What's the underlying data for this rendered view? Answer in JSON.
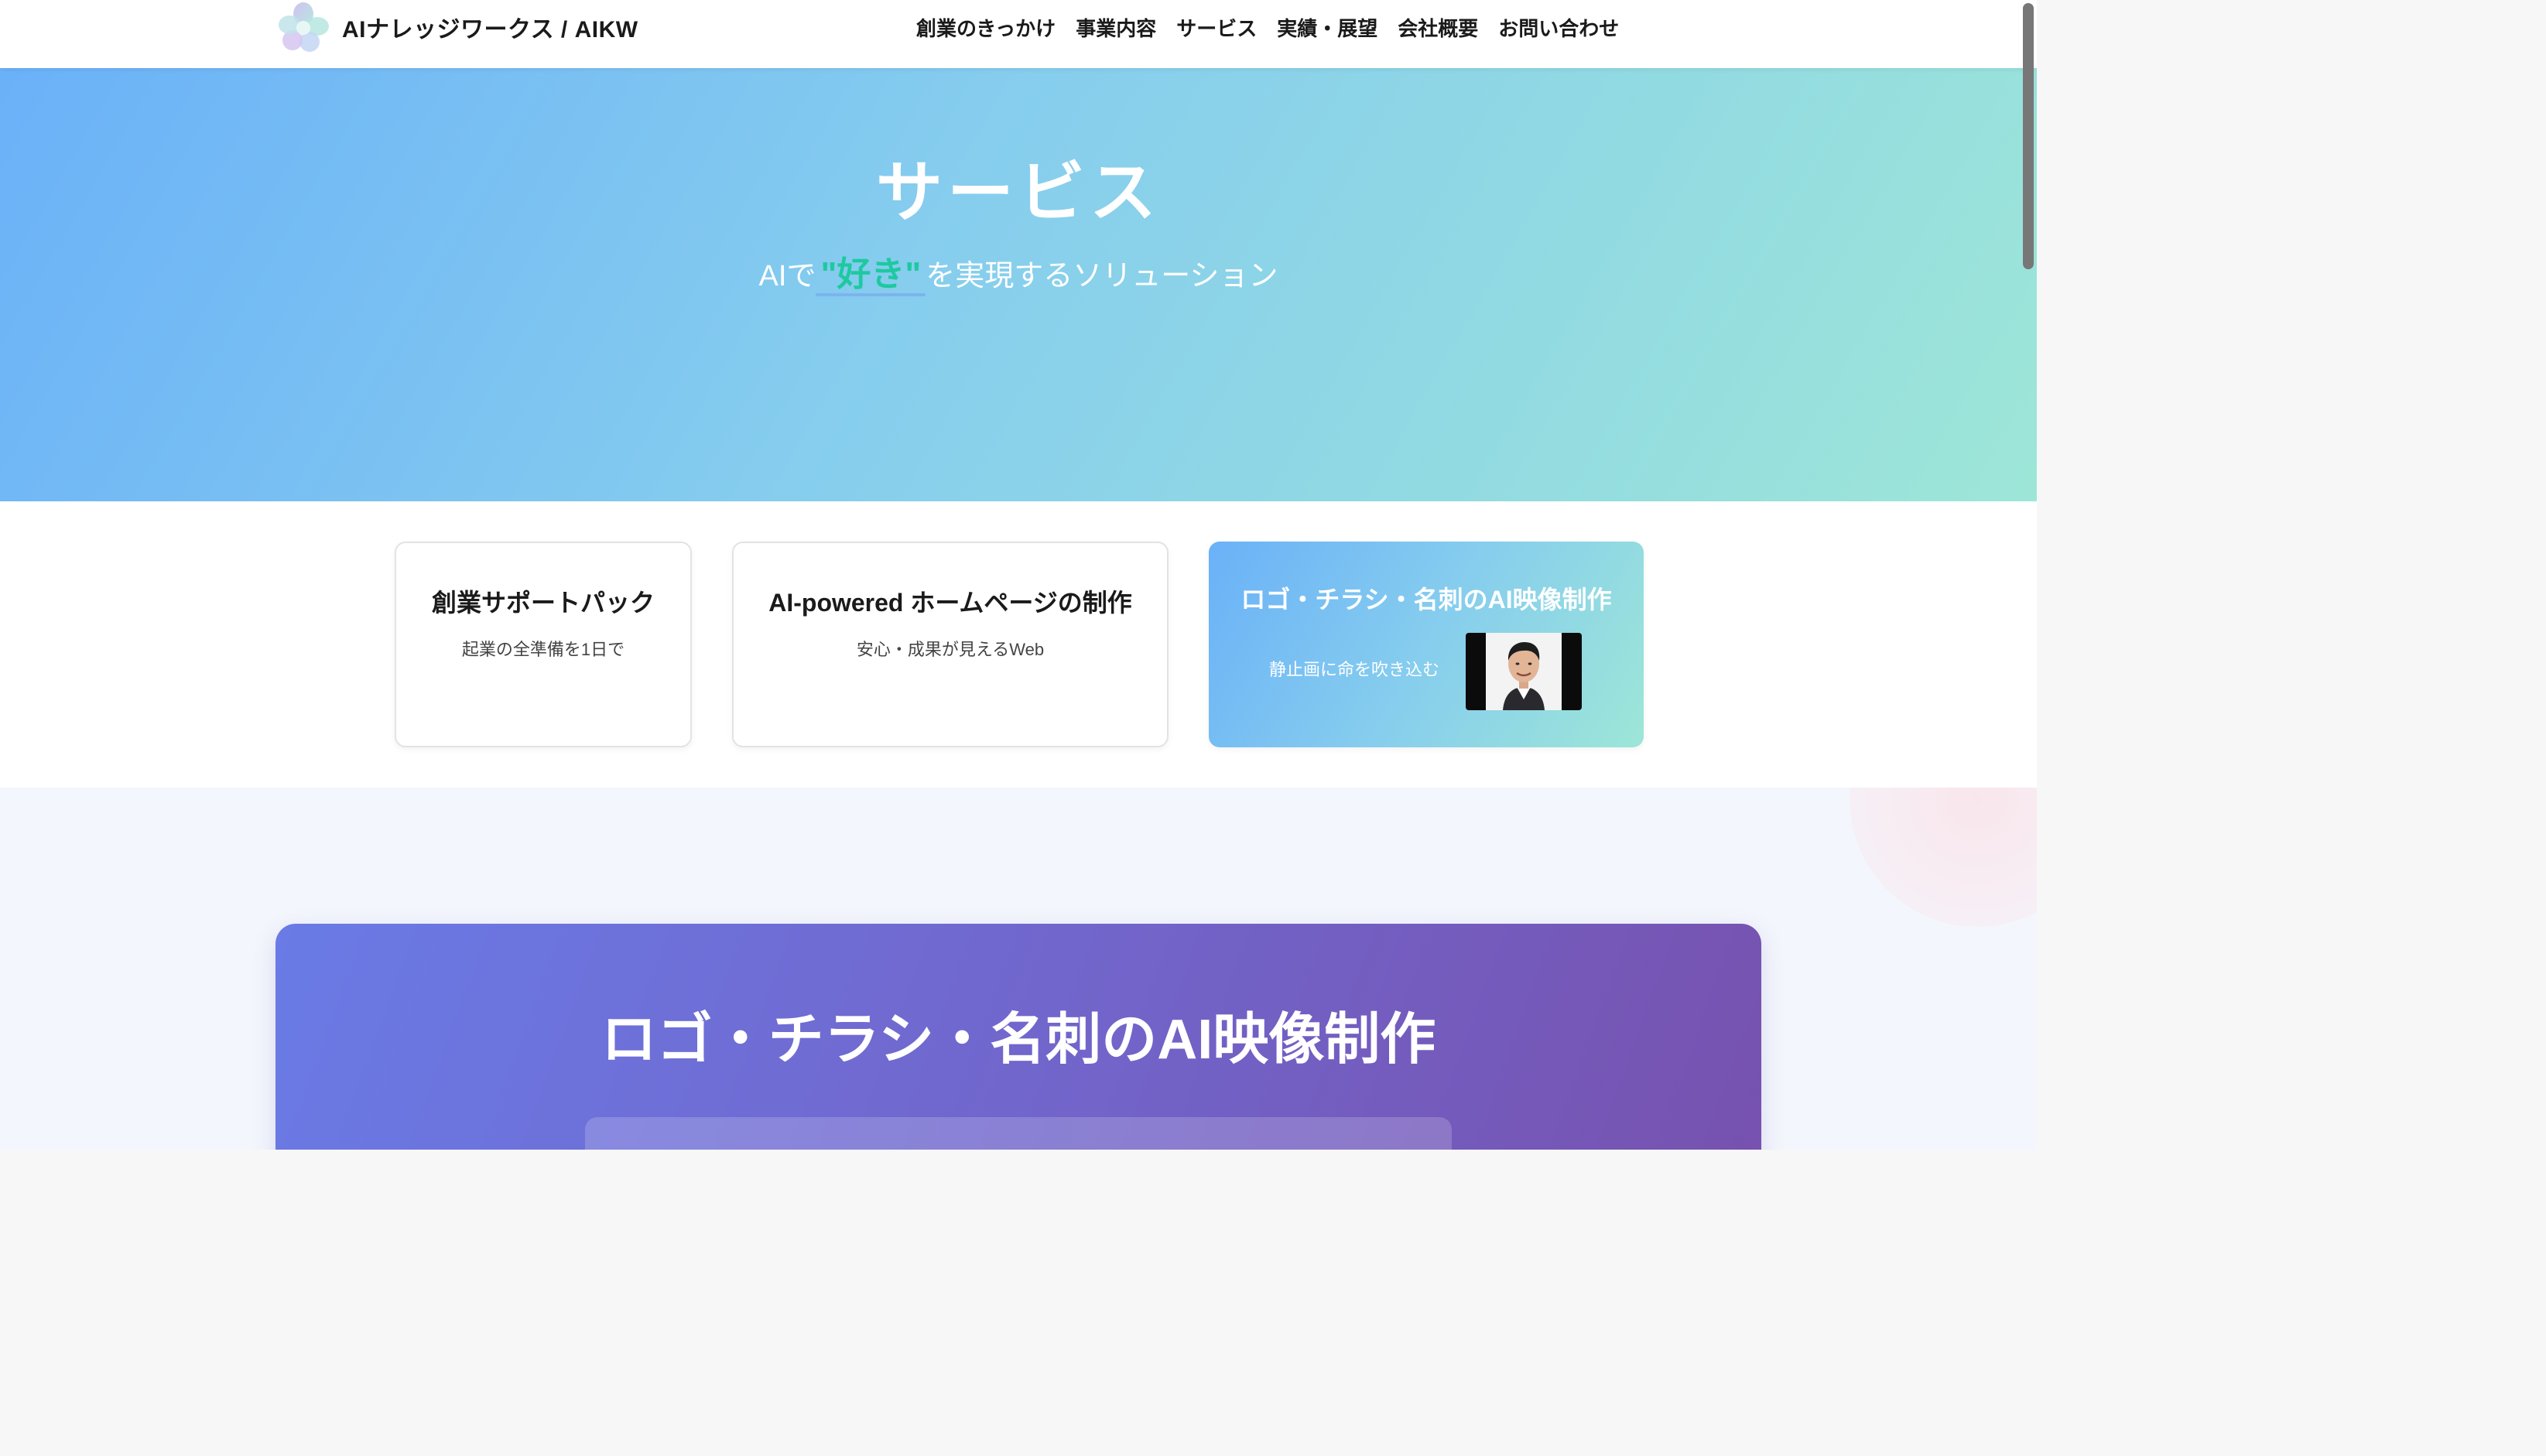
{
  "header": {
    "logo_text": "AIナレッジワークス / AIKW",
    "nav": [
      {
        "label": "創業のきっかけ"
      },
      {
        "label": "事業内容"
      },
      {
        "label": "サービス"
      },
      {
        "label": "実績・展望"
      },
      {
        "label": "会社概要"
      },
      {
        "label": "お問い合わせ"
      }
    ]
  },
  "hero": {
    "title": "サービス",
    "subtitle_prefix": "AIで",
    "subtitle_highlight": "\"好き\"",
    "subtitle_suffix": "を実現するソリューション"
  },
  "cards": [
    {
      "title": "創業サポートパック",
      "subtitle": "起業の全準備を1日で"
    },
    {
      "title": "AI-powered ホームページの制作",
      "subtitle": "安心・成果が見えるWeb"
    },
    {
      "title": "ロゴ・チラシ・名刺のAI映像制作",
      "subtitle": "静止画に命を吹き込む",
      "thumbnail_icon": "portrait-thumbnail"
    }
  ],
  "feature": {
    "title": "ロゴ・チラシ・名刺のAI映像制作"
  },
  "colors": {
    "hero_gradient_start": "#6ab1f8",
    "hero_gradient_end": "#9de6d7",
    "highlight": "#1ec9a0",
    "feature_gradient_start": "#6a7be6",
    "feature_gradient_end": "#7751ae"
  }
}
